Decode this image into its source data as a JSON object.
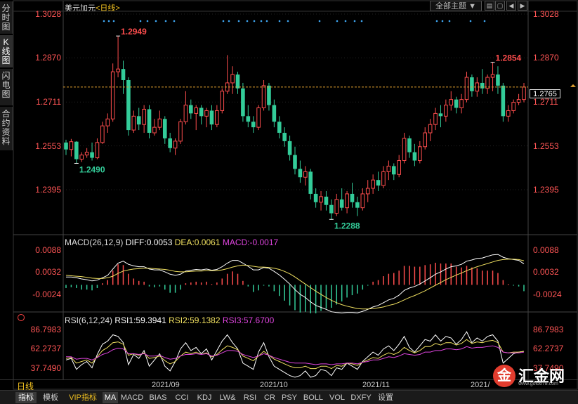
{
  "side_tabs": [
    {
      "label": "分时图",
      "chars": [
        "分",
        "时",
        "图"
      ],
      "active": false
    },
    {
      "label": "K线图",
      "chars": [
        "K",
        "线",
        "图"
      ],
      "active": true
    },
    {
      "label": "闪电图",
      "chars": [
        "闪",
        "电",
        "图"
      ],
      "active": false
    },
    {
      "label": "合约资料",
      "chars": [
        "合",
        "约",
        "资",
        "料"
      ],
      "active": false
    }
  ],
  "header": {
    "symbol": "美元加元",
    "period_tag": "<日线>",
    "theme_select": "全部主题",
    "theme_arrow": "▼"
  },
  "current_price": "1.2765",
  "price_axis": [
    "1.3028",
    "1.2870",
    "1.2711",
    "1.2553",
    "1.2395"
  ],
  "macd": {
    "title": "MACD(26,12,9)",
    "diff": "DIFF:0.0053",
    "dea": "DEA:0.0061",
    "macd": "MACD:-0.0017",
    "axis": [
      "0.0088",
      "0.0032",
      "-0.0024"
    ]
  },
  "rsi": {
    "title": "RSI(6,12,24)",
    "rsi1": "RSI1:59.3941",
    "rsi2": "RSI2:59.1382",
    "rsi3": "RSI3:57.6700",
    "axis": [
      "86.7983",
      "62.2737",
      "37.7490"
    ]
  },
  "period_label": "日线",
  "date_labels": [
    "2021/09",
    "2021/10",
    "2021/11",
    "2021/"
  ],
  "bottom_tabs": [
    "指标",
    "模板",
    "VIP指标",
    "MA",
    "MACD",
    "BIAS",
    "CCI",
    "KDJ",
    "LW&",
    "RSI",
    "CR",
    "PSY",
    "BOLL",
    "VOL",
    "DXFY",
    "设置"
  ],
  "logo": {
    "glyph": "金",
    "name": "汇金网",
    "url": "www.gold678.com"
  },
  "colors": {
    "up": "#ff4d4d",
    "down": "#33cc99",
    "diff": "#ffffff",
    "dea": "#f0e060",
    "rsi1": "#ffffff",
    "rsi2": "#f0e060",
    "rsi3": "#dd44dd",
    "axis_red": "#ff5555"
  },
  "chart_data": [
    {
      "type": "candlestick",
      "series_name": "美元加元",
      "ylim": [
        1.2238,
        1.3028
      ],
      "annotations": [
        {
          "text": "1.2949",
          "value": 1.2949,
          "kind": "high"
        },
        {
          "text": "1.2854",
          "value": 1.2854,
          "kind": "high"
        },
        {
          "text": "1.2490",
          "value": 1.249,
          "kind": "low"
        },
        {
          "text": "1.2288",
          "value": 1.2288,
          "kind": "low"
        }
      ],
      "last_price": 1.2765,
      "ohlc": [
        [
          1.2565,
          1.2575,
          1.252,
          1.254
        ],
        [
          1.254,
          1.2578,
          1.2515,
          1.2568
        ],
        [
          1.2568,
          1.257,
          1.249,
          1.2505
        ],
        [
          1.2505,
          1.253,
          1.2495,
          1.252
        ],
        [
          1.252,
          1.2545,
          1.251,
          1.253
        ],
        [
          1.253,
          1.2565,
          1.25,
          1.251
        ],
        [
          1.251,
          1.258,
          1.2505,
          1.2565
        ],
        [
          1.2565,
          1.264,
          1.256,
          1.2625
        ],
        [
          1.2625,
          1.267,
          1.26,
          1.265
        ],
        [
          1.265,
          1.285,
          1.264,
          1.282
        ],
        [
          1.282,
          1.2949,
          1.28,
          1.283
        ],
        [
          1.283,
          1.286,
          1.274,
          1.279
        ],
        [
          1.279,
          1.28,
          1.259,
          1.261
        ],
        [
          1.261,
          1.268,
          1.26,
          1.266
        ],
        [
          1.266,
          1.269,
          1.261,
          1.263
        ],
        [
          1.263,
          1.27,
          1.26,
          1.2685
        ],
        [
          1.2685,
          1.27,
          1.258,
          1.26
        ],
        [
          1.26,
          1.265,
          1.259,
          1.262
        ],
        [
          1.262,
          1.268,
          1.261,
          1.265
        ],
        [
          1.265,
          1.266,
          1.256,
          1.258
        ],
        [
          1.258,
          1.26,
          1.253,
          1.2545
        ],
        [
          1.2545,
          1.258,
          1.252,
          1.257
        ],
        [
          1.257,
          1.265,
          1.256,
          1.264
        ],
        [
          1.264,
          1.275,
          1.263,
          1.27
        ],
        [
          1.27,
          1.272,
          1.265,
          1.267
        ],
        [
          1.267,
          1.27,
          1.261,
          1.269
        ],
        [
          1.269,
          1.27,
          1.263,
          1.266
        ],
        [
          1.266,
          1.269,
          1.262,
          1.268
        ],
        [
          1.268,
          1.27,
          1.261,
          1.263
        ],
        [
          1.263,
          1.27,
          1.262,
          1.268
        ],
        [
          1.268,
          1.276,
          1.267,
          1.275
        ],
        [
          1.275,
          1.288,
          1.274,
          1.278
        ],
        [
          1.278,
          1.284,
          1.274,
          1.281
        ],
        [
          1.281,
          1.282,
          1.274,
          1.276
        ],
        [
          1.276,
          1.278,
          1.264,
          1.266
        ],
        [
          1.266,
          1.27,
          1.262,
          1.264
        ],
        [
          1.264,
          1.266,
          1.26,
          1.262
        ],
        [
          1.262,
          1.27,
          1.261,
          1.269
        ],
        [
          1.269,
          1.279,
          1.268,
          1.277
        ],
        [
          1.277,
          1.278,
          1.268,
          1.27
        ],
        [
          1.27,
          1.272,
          1.262,
          1.264
        ],
        [
          1.264,
          1.266,
          1.258,
          1.26
        ],
        [
          1.26,
          1.262,
          1.255,
          1.257
        ],
        [
          1.257,
          1.259,
          1.25,
          1.252
        ],
        [
          1.252,
          1.255,
          1.245,
          1.247
        ],
        [
          1.247,
          1.25,
          1.242,
          1.244
        ],
        [
          1.244,
          1.248,
          1.241,
          1.246
        ],
        [
          1.246,
          1.247,
          1.236,
          1.238
        ],
        [
          1.238,
          1.24,
          1.233,
          1.235
        ],
        [
          1.235,
          1.239,
          1.232,
          1.237
        ],
        [
          1.237,
          1.239,
          1.232,
          1.234
        ],
        [
          1.234,
          1.236,
          1.2288,
          1.231
        ],
        [
          1.231,
          1.238,
          1.23,
          1.236
        ],
        [
          1.236,
          1.24,
          1.232,
          1.233
        ],
        [
          1.233,
          1.239,
          1.231,
          1.238
        ],
        [
          1.238,
          1.242,
          1.233,
          1.235
        ],
        [
          1.235,
          1.237,
          1.23,
          1.233
        ],
        [
          1.233,
          1.24,
          1.232,
          1.238
        ],
        [
          1.238,
          1.243,
          1.235,
          1.24
        ],
        [
          1.24,
          1.245,
          1.238,
          1.243
        ],
        [
          1.243,
          1.246,
          1.239,
          1.241
        ],
        [
          1.241,
          1.248,
          1.24,
          1.246
        ],
        [
          1.246,
          1.25,
          1.243,
          1.248
        ],
        [
          1.248,
          1.249,
          1.243,
          1.245
        ],
        [
          1.245,
          1.252,
          1.244,
          1.25
        ],
        [
          1.25,
          1.26,
          1.249,
          1.258
        ],
        [
          1.258,
          1.259,
          1.251,
          1.253
        ],
        [
          1.253,
          1.256,
          1.248,
          1.25
        ],
        [
          1.25,
          1.257,
          1.249,
          1.255
        ],
        [
          1.255,
          1.262,
          1.254,
          1.26
        ],
        [
          1.26,
          1.265,
          1.257,
          1.263
        ],
        [
          1.263,
          1.269,
          1.261,
          1.267
        ],
        [
          1.267,
          1.27,
          1.262,
          1.266
        ],
        [
          1.266,
          1.272,
          1.264,
          1.27
        ],
        [
          1.27,
          1.275,
          1.268,
          1.272
        ],
        [
          1.272,
          1.273,
          1.267,
          1.269
        ],
        [
          1.269,
          1.274,
          1.267,
          1.272
        ],
        [
          1.272,
          1.282,
          1.271,
          1.28
        ],
        [
          1.28,
          1.281,
          1.273,
          1.275
        ],
        [
          1.275,
          1.28,
          1.273,
          1.278
        ],
        [
          1.278,
          1.283,
          1.274,
          1.276
        ],
        [
          1.276,
          1.281,
          1.274,
          1.28
        ],
        [
          1.28,
          1.2854,
          1.275,
          1.281
        ],
        [
          1.281,
          1.284,
          1.274,
          1.277
        ],
        [
          1.277,
          1.278,
          1.264,
          1.266
        ],
        [
          1.266,
          1.27,
          1.264,
          1.268
        ],
        [
          1.268,
          1.272,
          1.267,
          1.271
        ],
        [
          1.271,
          1.274,
          1.27,
          1.272
        ],
        [
          1.272,
          1.278,
          1.271,
          1.2765
        ]
      ]
    },
    {
      "type": "bar+line",
      "series_name": "MACD(26,12,9)",
      "ylim": [
        -0.0065,
        0.0095
      ],
      "series": [
        {
          "name": "DIFF",
          "values": [
            0.002,
            0.002,
            0.0018,
            0.0015,
            0.0013,
            0.001,
            0.0012,
            0.0018,
            0.0024,
            0.004,
            0.0055,
            0.006,
            0.0052,
            0.0048,
            0.0046,
            0.0046,
            0.004,
            0.0038,
            0.0038,
            0.0033,
            0.0027,
            0.0024,
            0.0027,
            0.0035,
            0.0037,
            0.0039,
            0.0038,
            0.004,
            0.0037,
            0.0039,
            0.0046,
            0.0055,
            0.0062,
            0.0062,
            0.0055,
            0.0047,
            0.0038,
            0.0038,
            0.0044,
            0.0042,
            0.0034,
            0.0025,
            0.0014,
            0.0002,
            -0.0012,
            -0.0024,
            -0.0032,
            -0.0043,
            -0.0052,
            -0.0057,
            -0.0062,
            -0.0068,
            -0.007,
            -0.0071,
            -0.007,
            -0.007,
            -0.0071,
            -0.0067,
            -0.0062,
            -0.0056,
            -0.0052,
            -0.0045,
            -0.0038,
            -0.0034,
            -0.0026,
            -0.0014,
            -0.0008,
            -0.0004,
            0.0002,
            0.001,
            0.0018,
            0.0027,
            0.0033,
            0.004,
            0.0046,
            0.0048,
            0.0052,
            0.006,
            0.0063,
            0.0067,
            0.0068,
            0.0072,
            0.0076,
            0.0077,
            0.007,
            0.0066,
            0.0064,
            0.0062,
            0.0053
          ]
        },
        {
          "name": "DEA",
          "values": [
            0.0024,
            0.0023,
            0.0022,
            0.0021,
            0.0019,
            0.0017,
            0.0016,
            0.0016,
            0.0018,
            0.0022,
            0.0029,
            0.0035,
            0.0038,
            0.004,
            0.0041,
            0.0042,
            0.0042,
            0.0041,
            0.004,
            0.0039,
            0.0037,
            0.0034,
            0.0033,
            0.0033,
            0.0034,
            0.0035,
            0.0035,
            0.0036,
            0.0036,
            0.0036,
            0.0038,
            0.0041,
            0.0045,
            0.0048,
            0.005,
            0.0049,
            0.0047,
            0.0045,
            0.0045,
            0.0044,
            0.0042,
            0.0039,
            0.0034,
            0.0028,
            0.002,
            0.0011,
            0.0002,
            -0.0007,
            -0.0016,
            -0.0024,
            -0.0032,
            -0.0039,
            -0.0045,
            -0.005,
            -0.0054,
            -0.0057,
            -0.006,
            -0.0061,
            -0.0061,
            -0.006,
            -0.0058,
            -0.0056,
            -0.0052,
            -0.0049,
            -0.0044,
            -0.0038,
            -0.0032,
            -0.0027,
            -0.0021,
            -0.0015,
            -0.0008,
            -0.0001,
            0.0006,
            0.0013,
            0.0019,
            0.0025,
            0.003,
            0.0036,
            0.0041,
            0.0046,
            0.005,
            0.0054,
            0.0058,
            0.0062,
            0.0064,
            0.0065,
            0.0065,
            0.0064,
            0.0061
          ]
        }
      ],
      "histogram": "MACD = 2 × (DIFF − DEA)"
    },
    {
      "type": "line",
      "series_name": "RSI(6,12,24)",
      "ylim": [
        25,
        93
      ],
      "series": [
        {
          "name": "RSI1",
          "values": [
            48,
            50,
            36,
            42,
            46,
            38,
            55,
            68,
            72,
            80,
            78,
            70,
            42,
            55,
            50,
            60,
            40,
            48,
            56,
            40,
            34,
            46,
            62,
            70,
            60,
            64,
            56,
            62,
            48,
            60,
            72,
            80,
            70,
            62,
            44,
            40,
            36,
            58,
            70,
            52,
            40,
            36,
            32,
            28,
            26,
            28,
            34,
            26,
            28,
            36,
            34,
            28,
            38,
            36,
            44,
            40,
            36,
            46,
            52,
            58,
            54,
            62,
            66,
            60,
            68,
            78,
            64,
            58,
            66,
            74,
            72,
            80,
            72,
            78,
            76,
            68,
            74,
            84,
            70,
            76,
            72,
            78,
            80,
            72,
            44,
            50,
            56,
            58,
            59
          ]
        },
        {
          "name": "RSI2",
          "values": [
            50,
            51,
            44,
            46,
            48,
            44,
            52,
            60,
            64,
            70,
            71,
            68,
            54,
            56,
            54,
            57,
            50,
            51,
            53,
            47,
            43,
            46,
            53,
            58,
            56,
            58,
            55,
            57,
            52,
            55,
            61,
            66,
            64,
            61,
            53,
            50,
            47,
            53,
            59,
            54,
            49,
            46,
            43,
            40,
            38,
            38,
            40,
            37,
            37,
            40,
            40,
            37,
            41,
            40,
            44,
            43,
            41,
            45,
            48,
            51,
            50,
            54,
            57,
            55,
            58,
            64,
            60,
            57,
            60,
            65,
            65,
            69,
            67,
            70,
            70,
            67,
            69,
            74,
            69,
            71,
            70,
            72,
            73,
            70,
            58,
            57,
            58,
            58,
            59
          ]
        },
        {
          "name": "RSI3",
          "values": [
            52,
            52,
            49,
            50,
            50,
            48,
            51,
            55,
            57,
            61,
            63,
            62,
            56,
            56,
            55,
            56,
            53,
            53,
            54,
            51,
            49,
            50,
            53,
            55,
            55,
            56,
            55,
            56,
            53,
            54,
            57,
            60,
            60,
            59,
            55,
            53,
            51,
            53,
            56,
            54,
            51,
            49,
            47,
            45,
            44,
            44,
            44,
            43,
            42,
            43,
            43,
            42,
            43,
            43,
            44,
            44,
            43,
            45,
            46,
            48,
            48,
            50,
            52,
            51,
            53,
            56,
            55,
            54,
            55,
            58,
            58,
            60,
            60,
            62,
            62,
            61,
            62,
            65,
            63,
            64,
            64,
            65,
            66,
            64,
            58,
            57,
            57,
            57,
            58
          ]
        }
      ]
    }
  ]
}
